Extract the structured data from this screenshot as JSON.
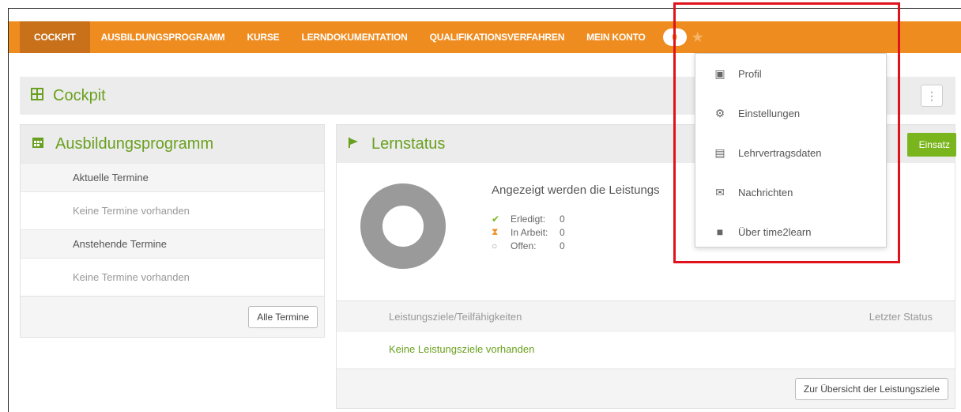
{
  "nav": {
    "items": [
      {
        "label": "COCKPIT",
        "active": true
      },
      {
        "label": "AUSBILDUNGSPROGRAMM"
      },
      {
        "label": "KURSE"
      },
      {
        "label": "LERNDOKUMENTATION"
      },
      {
        "label": "QUALIFIKATIONSVERFAHREN"
      },
      {
        "label": "MEIN KONTO"
      }
    ],
    "badge": "0",
    "star_icon": "star-icon"
  },
  "cockpit": {
    "title": "Cockpit",
    "icon": "grid-icon",
    "menu_icon": "kebab-icon"
  },
  "ausbildung": {
    "title": "Ausbildungsprogramm",
    "icon": "calendar-icon",
    "current_label": "Aktuelle Termine",
    "current_empty": "Keine Termine vorhanden",
    "upcoming_label": "Anstehende Termine",
    "upcoming_empty": "Keine Termine vorhanden",
    "all_button": "Alle Termine"
  },
  "lernstatus": {
    "title": "Lernstatus",
    "icon": "flag-icon",
    "einsatz_button": "Einsatz",
    "description": "Angezeigt werden die Leistungs",
    "legend": [
      {
        "label": "Erledigt:",
        "value": "0",
        "icon": "check-icon",
        "color": "#7ab51d"
      },
      {
        "label": "In Arbeit:",
        "value": "0",
        "icon": "hourglass-icon",
        "color": "#ef8c1f"
      },
      {
        "label": "Offen:",
        "value": "0",
        "icon": "circle-icon",
        "color": "#999999"
      }
    ],
    "col_goals": "Leistungsziele/Teilfähigkeiten",
    "col_status": "Letzter Status",
    "empty": "Keine Leistungsziele vorhanden",
    "overview_button": "Zur Übersicht der Leistungsziele"
  },
  "dropdown": {
    "items": [
      {
        "label": "Profil",
        "icon": "id-card-icon"
      },
      {
        "label": "Einstellungen",
        "icon": "gear-icon"
      },
      {
        "label": "Lehrvertragsdaten",
        "icon": "briefcase-icon"
      },
      {
        "label": "Nachrichten",
        "icon": "envelope-icon"
      },
      {
        "label": "Über time2learn",
        "icon": "info-icon"
      }
    ]
  },
  "colors": {
    "nav": "#ef8c1f",
    "nav_active": "#c9701a",
    "accent_green": "#6aa01f",
    "highlight": "#e0131d"
  }
}
